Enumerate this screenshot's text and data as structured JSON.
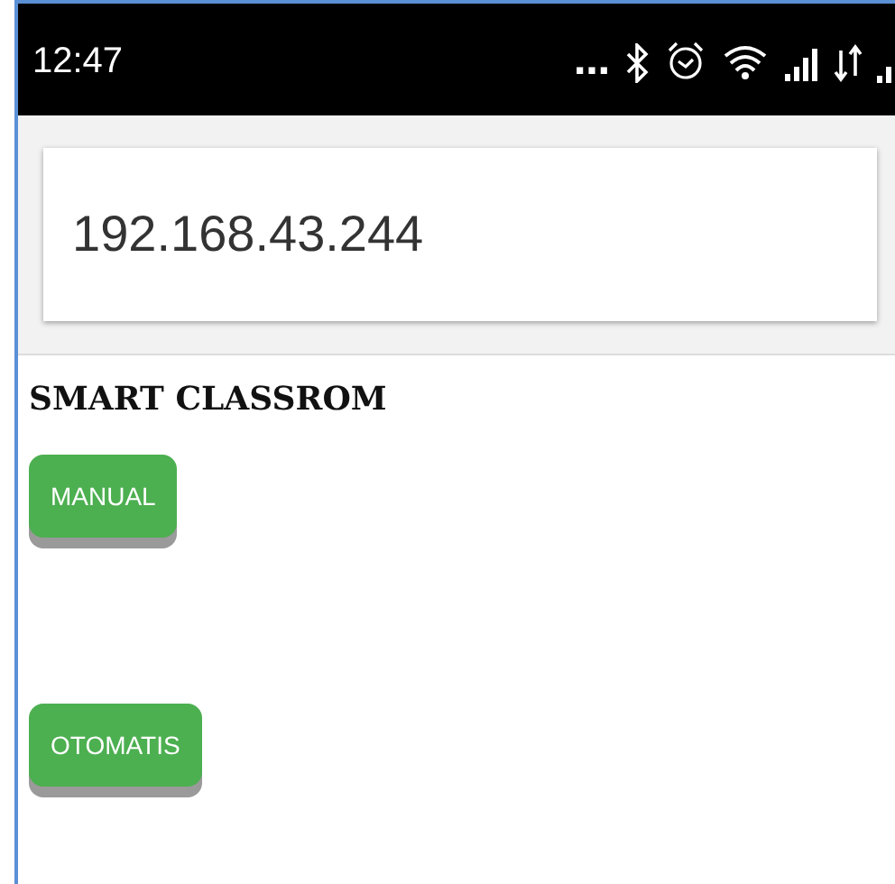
{
  "status_bar": {
    "time": "12:47",
    "overflow": "…"
  },
  "address_bar": {
    "value": "192.168.43.244"
  },
  "heading": "SMART CLASSROM",
  "buttons": [
    {
      "label": "MANUAL"
    },
    {
      "label": "OTOMATIS"
    }
  ]
}
